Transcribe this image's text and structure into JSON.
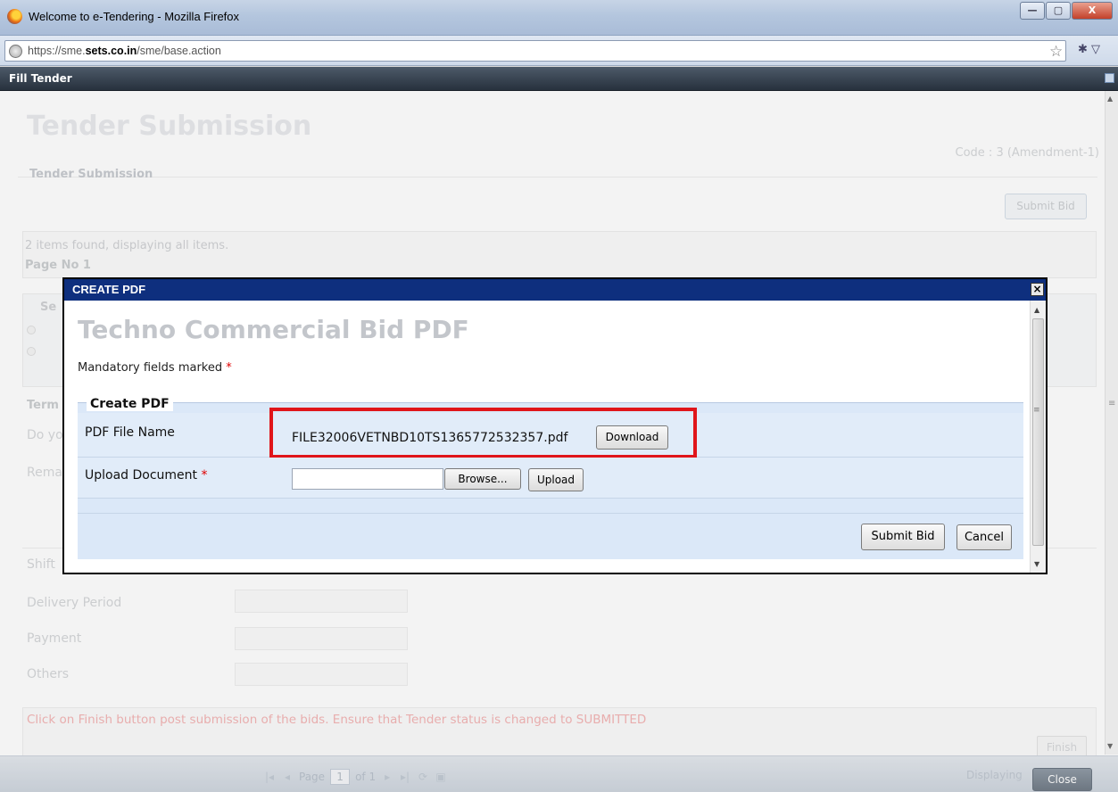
{
  "browser": {
    "window_title": "Welcome to e-Tendering - Mozilla Firefox",
    "url_prefix": "https://sme.",
    "url_domain": "sets.co.in",
    "url_suffix": "/sme/base.action",
    "minimize_glyph": "—",
    "maximize_glyph": "▢",
    "close_glyph": "X"
  },
  "panel": {
    "title": "Fill Tender"
  },
  "page": {
    "title": "Tender Submission",
    "code": "Code : 3 (Amendment-1)",
    "section_legend": "Tender Submission",
    "submit_bid_label": "Submit Bid",
    "items_found": "2 items found, displaying all items.",
    "page_no": "Page No 1",
    "grid_header_select": "Se",
    "terms_label": "Term",
    "do_you_label": "Do yo",
    "remarks_label": "Rema",
    "shift_label": "Shift",
    "delivery_label": "Delivery Period",
    "payment_label": "Payment",
    "others_label": "Others",
    "finish_note": "Click on Finish button post submission of the bids. Ensure that Tender status is changed to SUBMITTED",
    "finish_label": "Finish"
  },
  "footer": {
    "page_label": "Page",
    "page_value": "1",
    "of_label": "of 1",
    "displaying": "Displaying",
    "close_label": "Close"
  },
  "modal": {
    "title": "CREATE PDF",
    "close_glyph": "×",
    "heading": "Techno Commercial Bid PDF",
    "mandatory_note": "Mandatory fields marked",
    "required_mark": "*",
    "fieldset_legend": "Create PDF",
    "pdf_file_label": "PDF File Name",
    "pdf_file_name": "FILE32006VETNBD10TS1365772532357.pdf",
    "download_label": "Download",
    "upload_label": "Upload Document",
    "upload_value": "",
    "browse_label": "Browse...",
    "upload_button_label": "Upload",
    "submit_bid_label": "Submit Bid",
    "cancel_label": "Cancel"
  },
  "colors": {
    "modal_header": "#0e2f7e",
    "highlight": "#e0151a",
    "required": "#e00000"
  }
}
